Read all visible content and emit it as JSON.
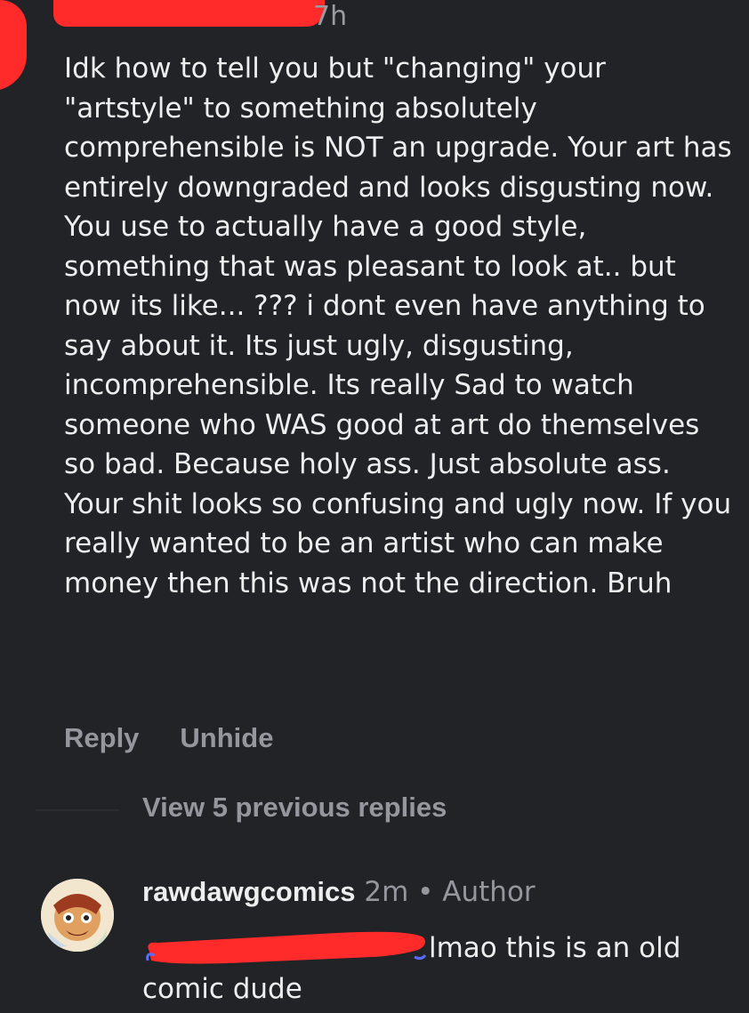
{
  "comment": {
    "timestamp": "7h",
    "body": "Idk how to tell you but \"changing\" your \"artstyle\" to something absolutely comprehensible is NOT an upgrade. Your art has entirely downgraded and looks disgusting now. You use to actually have a good style, something that was pleasant to look at.. but now its like... ??? i dont even have anything to say about it. Its just ugly, disgusting, incomprehensible. Its really Sad to watch someone who WAS good at art do themselves so bad. Because holy ass. Just absolute ass. Your shit looks so confusing and ugly now. If you really wanted to be an artist who can make money then this was not the direction. Bruh",
    "actions": {
      "reply": "Reply",
      "unhide": "Unhide"
    }
  },
  "thread": {
    "view_previous": "View 5 previous replies"
  },
  "reply": {
    "author": "rawdawgcomics",
    "timestamp": "2m",
    "separator": "•",
    "role": "Author",
    "text": "lmao this is an old comic dude"
  },
  "colors": {
    "background": "#222327",
    "text": "#eeeeee",
    "muted": "#95979e",
    "redaction": "#ff2a2a"
  }
}
